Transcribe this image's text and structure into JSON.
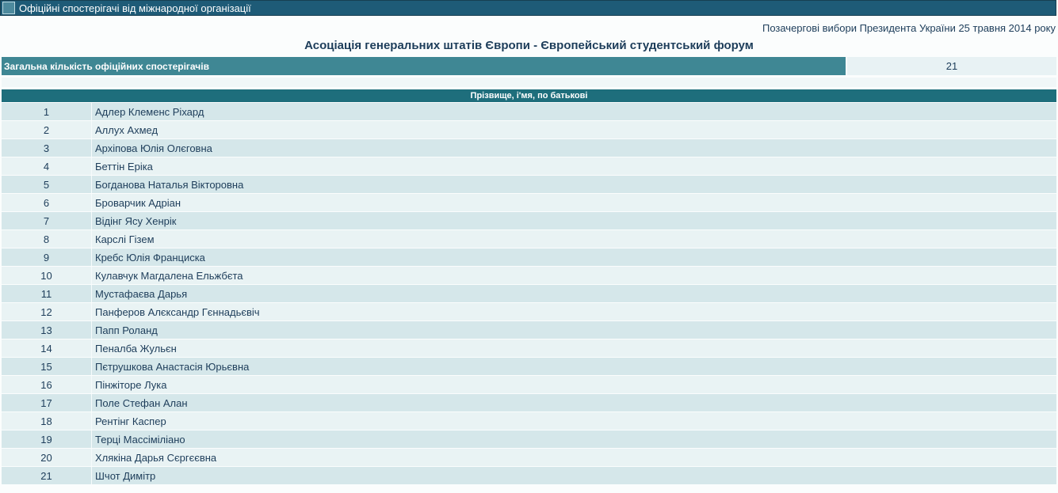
{
  "header": {
    "title": "Офіційні спостерігачі від міжнародної організації"
  },
  "election": "Позачергові вибори Президента України 25 травня 2014 року",
  "organization": "Асоціація генеральних штатів Європи - Європейський студентський форум",
  "total": {
    "label": "Загальна кількість офіційних спостерігачів",
    "value": "21"
  },
  "table": {
    "column_header": "Прізвище, і'мя, по батькові",
    "rows": [
      {
        "num": "1",
        "name": "Адлер Клеменс Ріхард"
      },
      {
        "num": "2",
        "name": "Аллух Ахмед"
      },
      {
        "num": "3",
        "name": "Архіпова Юлія Олєговна"
      },
      {
        "num": "4",
        "name": "Беттін Еріка"
      },
      {
        "num": "5",
        "name": "Богданова Наталья Вікторовна"
      },
      {
        "num": "6",
        "name": "Броварчик Адріан"
      },
      {
        "num": "7",
        "name": "Відінг Ясу Хенрік"
      },
      {
        "num": "8",
        "name": "Карслі Гізем"
      },
      {
        "num": "9",
        "name": "Кребс Юлія Франциска"
      },
      {
        "num": "10",
        "name": "Кулавчук Магдалена Ельжбєта"
      },
      {
        "num": "11",
        "name": "Мустафаєва Дарья"
      },
      {
        "num": "12",
        "name": "Панферов Алєксандр Гєннадьєвіч"
      },
      {
        "num": "13",
        "name": "Папп Роланд"
      },
      {
        "num": "14",
        "name": "Пеналба Жульєн"
      },
      {
        "num": "15",
        "name": "Пєтрушкова Анастасія Юрьєвна"
      },
      {
        "num": "16",
        "name": "Пінжіторе Лука"
      },
      {
        "num": "17",
        "name": "Поле Стефан Алан"
      },
      {
        "num": "18",
        "name": "Рентінг Каспер"
      },
      {
        "num": "19",
        "name": "Терці Массіміліано"
      },
      {
        "num": "20",
        "name": "Хлякіна Дарья Сєргєєвна"
      },
      {
        "num": "21",
        "name": "Шчот Димітр"
      }
    ]
  },
  "colors": {
    "title_bar": "#1e5b77",
    "total_label_bg": "#3f8794",
    "list_header_bg": "#1e6e7c",
    "row_odd": "#d5e7ea",
    "row_even": "#e9f3f4",
    "text": "#1d3d5a"
  }
}
